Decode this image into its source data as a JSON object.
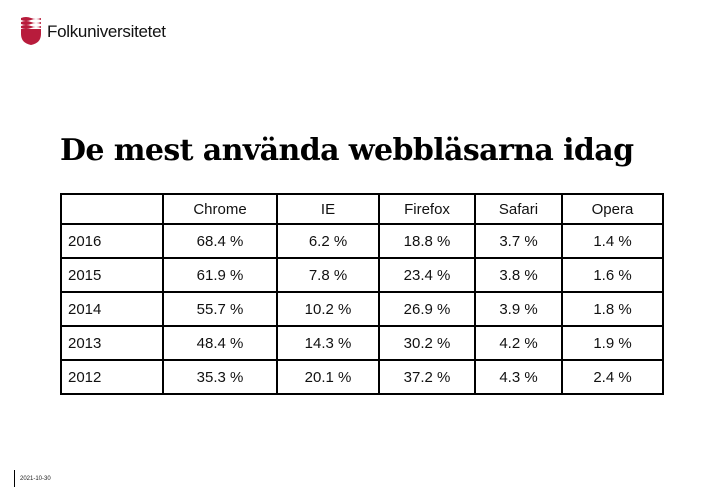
{
  "logo": {
    "icon": "folkuniversitetet-shield-icon",
    "text": "Folkuniversitetet",
    "brand_color": "#b81c3c"
  },
  "title": "De mest använda webbläsarna idag",
  "table": {
    "corner": "",
    "columns": [
      "Chrome",
      "IE",
      "Firefox",
      "Safari",
      "Opera"
    ],
    "rows": [
      {
        "year": "2016",
        "values": [
          "68.4 %",
          "6.2 %",
          "18.8 %",
          "3.7 %",
          "1.4 %"
        ]
      },
      {
        "year": "2015",
        "values": [
          "61.9 %",
          "7.8 %",
          "23.4 %",
          "3.8 %",
          "1.6 %"
        ]
      },
      {
        "year": "2014",
        "values": [
          "55.7 %",
          "10.2 %",
          "26.9 %",
          "3.9 %",
          "1.8 %"
        ]
      },
      {
        "year": "2013",
        "values": [
          "48.4 %",
          "14.3 %",
          "30.2 %",
          "4.2 %",
          "1.9 %"
        ]
      },
      {
        "year": "2012",
        "values": [
          "35.3 %",
          "20.1 %",
          "37.2 %",
          "4.3 %",
          "2.4 %"
        ]
      }
    ]
  },
  "footer": {
    "date": "2021-10-30"
  }
}
